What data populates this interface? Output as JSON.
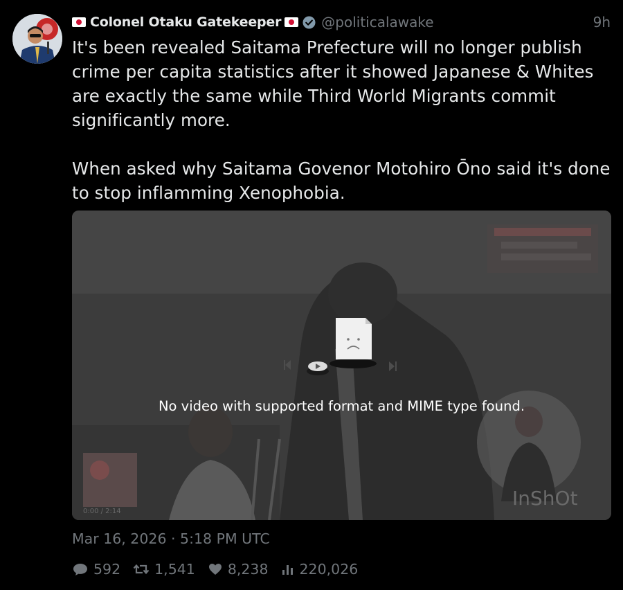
{
  "tweet": {
    "display_name": "Colonel Otaku Gatekeeper",
    "handle": "@politicalawake",
    "time_ago": "9h",
    "text": "It's been revealed Saitama Prefecture will no longer publish crime per capita statistics after it showed Japanese & Whites are exactly the same while Third World Migrants commit significantly more.\n\nWhen asked why Saitama Govenor Motohiro Ōno said it's done to stop inflamming Xenophobia.",
    "timestamp": "Mar 16, 2026 · 5:18 PM UTC",
    "icons": {
      "name_prefix": "japan-flag-icon",
      "name_suffix": "japan-flag-icon",
      "verified": "verified-badge-icon",
      "reply": "reply-icon",
      "retweet": "retweet-icon",
      "like": "heart-icon",
      "views": "views-icon"
    },
    "colors": {
      "background": "#000000",
      "text": "#e7e9ea",
      "muted": "#71767b",
      "verified": "#829aab",
      "flag_red": "#d21034"
    }
  },
  "media": {
    "error_message": "No video with supported format and MIME type found.",
    "watermark": "InShOt",
    "player_time": "0:00 / 2:14"
  },
  "stats": {
    "replies": "592",
    "retweets": "1,541",
    "likes": "8,238",
    "views": "220,026"
  }
}
